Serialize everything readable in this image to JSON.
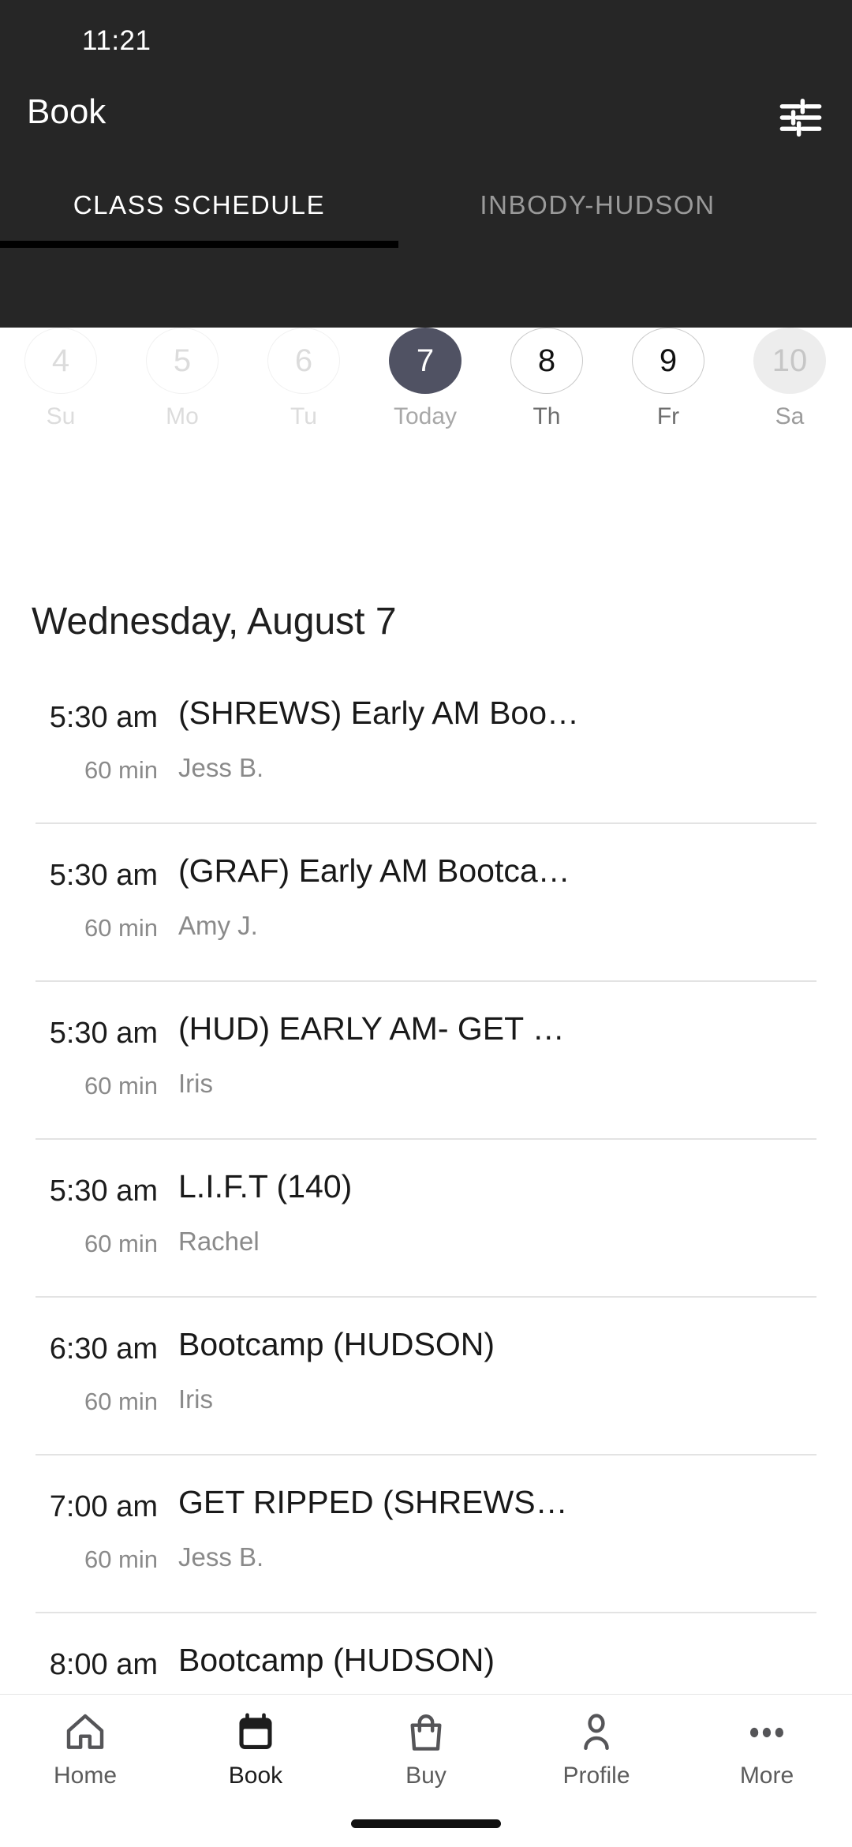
{
  "status_bar": {
    "time": "11:21"
  },
  "app_bar": {
    "title": "Book",
    "filter_icon": "tune-icon"
  },
  "tabs": [
    {
      "label": "CLASS SCHEDULE",
      "active": true
    },
    {
      "label": "INBODY-HUDSON",
      "active": false
    }
  ],
  "date_strip": [
    {
      "day": "4",
      "weekday": "Su",
      "state": "past"
    },
    {
      "day": "5",
      "weekday": "Mo",
      "state": "past"
    },
    {
      "day": "6",
      "weekday": "Tu",
      "state": "past"
    },
    {
      "day": "7",
      "weekday": "Today",
      "state": "today"
    },
    {
      "day": "8",
      "weekday": "Th",
      "state": "normal"
    },
    {
      "day": "9",
      "weekday": "Fr",
      "state": "normal"
    },
    {
      "day": "10",
      "weekday": "Sa",
      "state": "tinted"
    }
  ],
  "schedule": {
    "day_heading": "Wednesday, August 7",
    "classes": [
      {
        "time": "5:30 am",
        "duration": "60 min",
        "name": "(SHREWS) Early AM Boo…",
        "coach": "Jess B."
      },
      {
        "time": "5:30 am",
        "duration": "60 min",
        "name": "(GRAF) Early AM Bootca…",
        "coach": "Amy J."
      },
      {
        "time": "5:30 am",
        "duration": "60 min",
        "name": "(HUD) EARLY AM- GET …",
        "coach": "Iris"
      },
      {
        "time": "5:30 am",
        "duration": "60 min",
        "name": "L.I.F.T (140)",
        "coach": "Rachel"
      },
      {
        "time": "6:30 am",
        "duration": "60 min",
        "name": "Bootcamp (HUDSON)",
        "coach": "Iris"
      },
      {
        "time": "7:00 am",
        "duration": "60 min",
        "name": "GET RIPPED (SHREWS…",
        "coach": "Jess B."
      },
      {
        "time": "8:00 am",
        "duration": "",
        "name": "Bootcamp (HUDSON)",
        "coach": ""
      }
    ]
  },
  "bottom_nav": [
    {
      "label": "Home",
      "icon": "home-icon",
      "active": false
    },
    {
      "label": "Book",
      "icon": "calendar-icon",
      "active": true
    },
    {
      "label": "Buy",
      "icon": "bag-icon",
      "active": false
    },
    {
      "label": "Profile",
      "icon": "person-icon",
      "active": false
    },
    {
      "label": "More",
      "icon": "more-icon",
      "active": false
    }
  ],
  "colors": {
    "header_bg": "#262626",
    "today_circle": "#505263",
    "tab_indicator": "#000000",
    "tinted_circle": "#ededed",
    "muted_text": "#8a8a8a"
  }
}
